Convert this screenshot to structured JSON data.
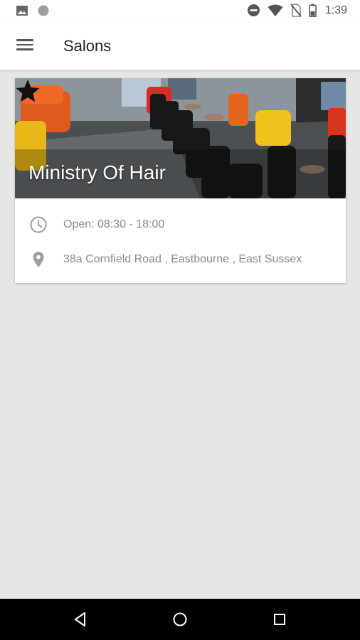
{
  "status_bar": {
    "time": "1:39",
    "left_icons": [
      "image-icon",
      "circle-icon"
    ],
    "right_icons": [
      "do-not-disturb-icon",
      "wifi-icon",
      "no-sim-icon",
      "battery-icon"
    ]
  },
  "app_bar": {
    "title": "Salons",
    "menu_icon": "hamburger-menu-icon"
  },
  "salons": [
    {
      "name": "Ministry Of Hair",
      "hours": "Open: 08:30 - 18:00",
      "address": "38a Cornfield Road , Eastbourne , East Sussex",
      "favorite_icon": "star-icon",
      "hours_icon": "clock-icon",
      "address_icon": "location-pin-icon"
    }
  ],
  "nav_bar": {
    "buttons": [
      "back-icon",
      "home-icon",
      "recents-icon"
    ]
  },
  "colors": {
    "background": "#e6e6e6",
    "app_bar": "#ffffff",
    "card": "#ffffff",
    "secondary_text": "#8a8a8a",
    "nav_bar": "#000000"
  }
}
